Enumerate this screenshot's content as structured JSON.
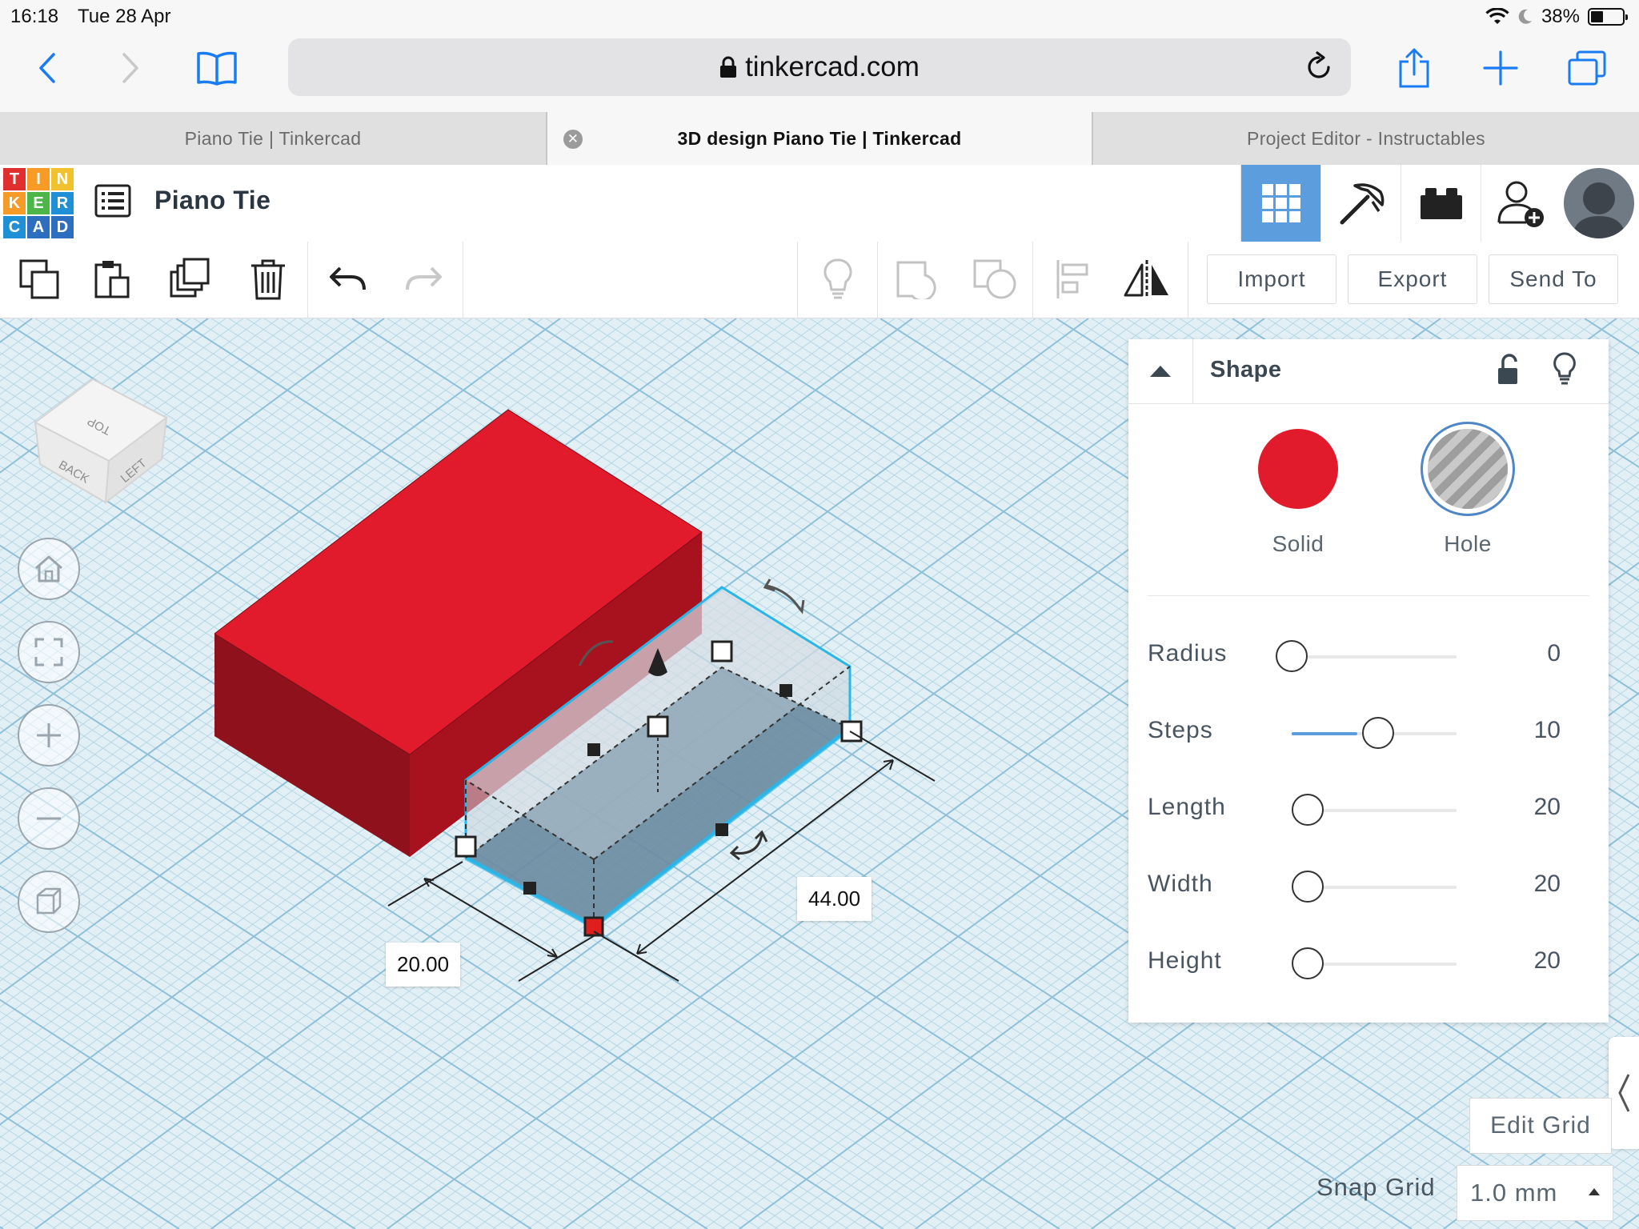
{
  "status_bar": {
    "time": "16:18",
    "date": "Tue 28 Apr",
    "battery": "38%"
  },
  "safari": {
    "url": "tinkercad.com"
  },
  "tabs": [
    {
      "label": "Piano Tie | Tinkercad",
      "active": false
    },
    {
      "label": "3D design Piano Tie | Tinkercad",
      "active": true
    },
    {
      "label": "Project Editor - Instructables",
      "active": false
    }
  ],
  "header": {
    "logo_letters": [
      "T",
      "I",
      "N",
      "K",
      "E",
      "R",
      "C",
      "A",
      "D"
    ],
    "design_title": "Piano Tie"
  },
  "toolbar": {
    "import_label": "Import",
    "export_label": "Export",
    "send_to_label": "Send To"
  },
  "view_cube": {
    "top": "TOP",
    "back": "BACK",
    "left": "LEFT"
  },
  "inspector": {
    "title": "Shape",
    "solid_label": "Solid",
    "hole_label": "Hole",
    "properties": [
      {
        "label": "Radius",
        "value": "0",
        "level": 0.0
      },
      {
        "label": "Steps",
        "value": "10",
        "level": 0.4
      },
      {
        "label": "Length",
        "value": "20",
        "level": 0.1
      },
      {
        "label": "Width",
        "value": "20",
        "level": 0.1
      },
      {
        "label": "Height",
        "value": "20",
        "level": 0.1
      }
    ]
  },
  "dimensions": {
    "width": "20.00",
    "length": "44.00"
  },
  "grid": {
    "edit_label": "Edit Grid",
    "snap_label": "Snap Grid",
    "snap_value": "1.0 mm"
  },
  "colors": {
    "brand_blue": "#5b9ddd",
    "solid_red": "#e11b2b",
    "selection_cyan": "#29b6e8"
  }
}
